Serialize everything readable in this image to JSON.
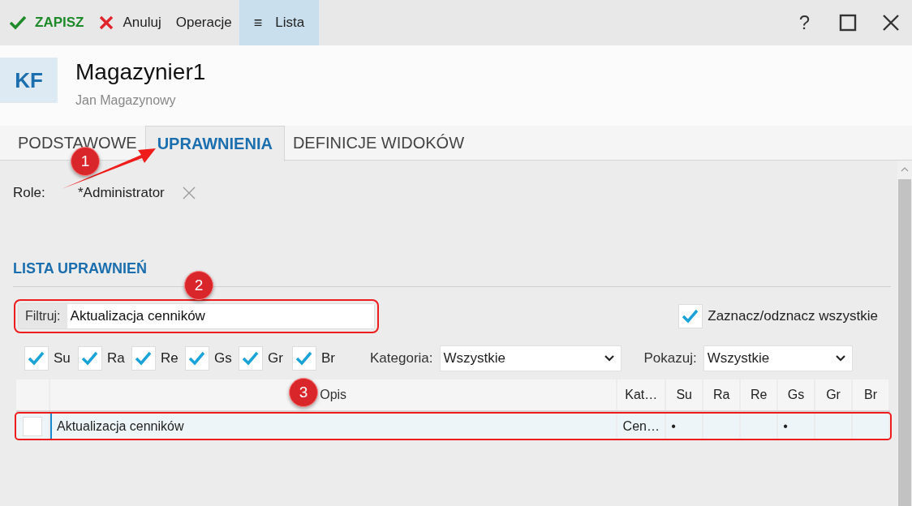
{
  "toolbar": {
    "buttons": [
      {
        "kind": "save",
        "label": "ZAPISZ",
        "selected": false
      },
      {
        "kind": "cancel",
        "label": "Anuluj",
        "selected": false
      },
      {
        "kind": "plain",
        "label": "Operacje",
        "selected": false
      },
      {
        "kind": "menu",
        "icon": "≡",
        "label": "Lista",
        "selected": true
      }
    ],
    "help": "?"
  },
  "header": {
    "avatar": "KF",
    "title": "Magazynier1",
    "subtitle": "Jan Magazynowy"
  },
  "tabs": [
    {
      "label": "PODSTAWOWE",
      "selected": false
    },
    {
      "label": "UPRAWNIENIA",
      "selected": true
    },
    {
      "label": "DEFINICJE WIDOKÓW",
      "selected": false
    }
  ],
  "roles": {
    "label": "Role:",
    "items": [
      {
        "name": "*Administrator"
      }
    ]
  },
  "section_title": "LISTA UPRAWNIEŃ",
  "filter": {
    "label": "Filtruj:",
    "value": "Aktualizacja cenników",
    "highlighted": true
  },
  "select_all": {
    "label": "Zaznacz/odznacz wszystkie",
    "checked": true
  },
  "column_toggles": [
    {
      "label": "Su",
      "checked": true
    },
    {
      "label": "Ra",
      "checked": true
    },
    {
      "label": "Re",
      "checked": true
    },
    {
      "label": "Gs",
      "checked": true
    },
    {
      "label": "Gr",
      "checked": true
    },
    {
      "label": "Br",
      "checked": true
    }
  ],
  "category": {
    "label": "Kategoria:",
    "value": "Wszystkie"
  },
  "show": {
    "label": "Pokazuj:",
    "value": "Wszystkie"
  },
  "table": {
    "columns": [
      "Opis",
      "Kat…",
      "Su",
      "Ra",
      "Re",
      "Gs",
      "Gr",
      "Br"
    ],
    "rows": [
      {
        "checked": false,
        "selected": true,
        "highlighted": true,
        "description": "Aktualizacja cenników",
        "category": "Cen…",
        "cells": [
          "•",
          null,
          null,
          "•",
          null,
          null
        ]
      }
    ]
  },
  "annotations": [
    {
      "kind": "badge-arrow",
      "label": "1"
    },
    {
      "kind": "badge",
      "label": "2"
    },
    {
      "kind": "badge",
      "label": "3"
    }
  ]
}
